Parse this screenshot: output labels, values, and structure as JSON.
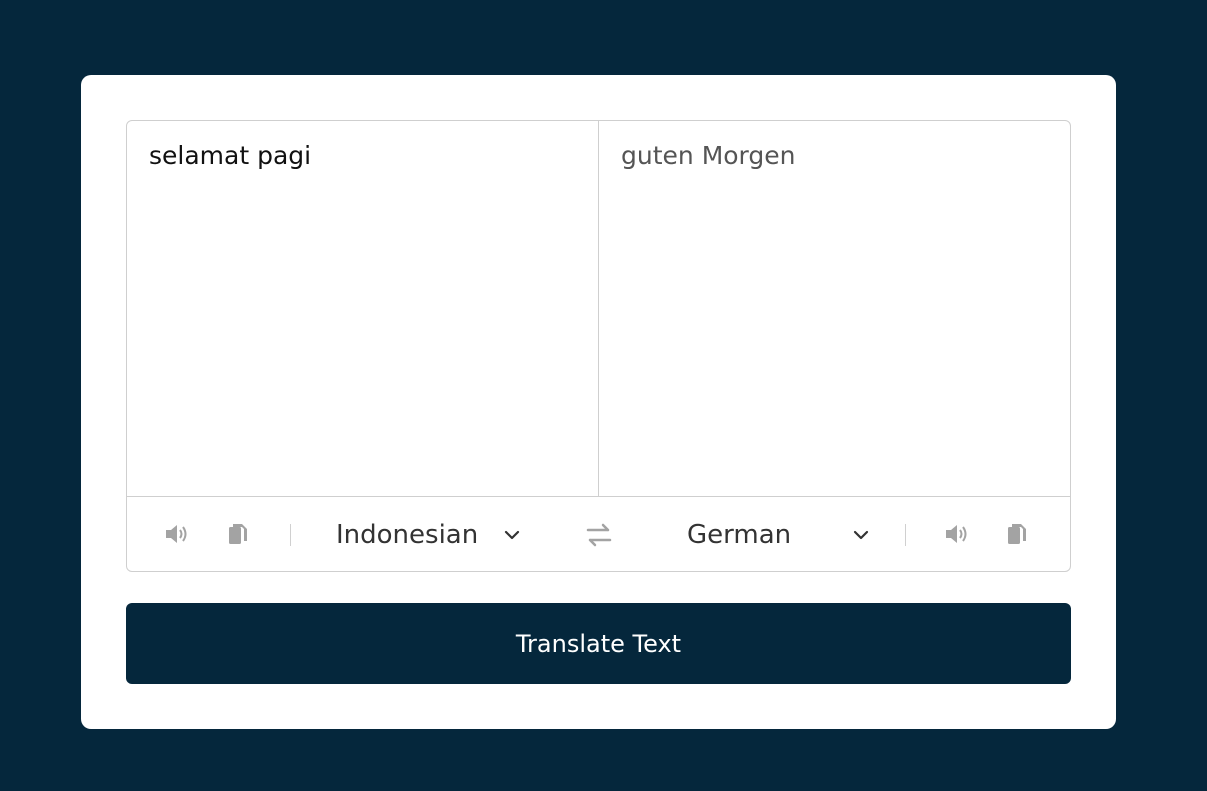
{
  "translator": {
    "source_text": "selamat pagi",
    "translated_text": "guten Morgen",
    "from_language": "Indonesian",
    "to_language": "German",
    "icons": {
      "speak": "volume-icon",
      "copy": "copy-icon",
      "swap": "exchange-icon",
      "dropdown": "chevron-down-icon"
    }
  },
  "translate_button_label": "Translate Text",
  "colors": {
    "background": "#05273c",
    "card": "#ffffff",
    "icon": "#9e9e9e",
    "border": "#cfcfcf"
  }
}
